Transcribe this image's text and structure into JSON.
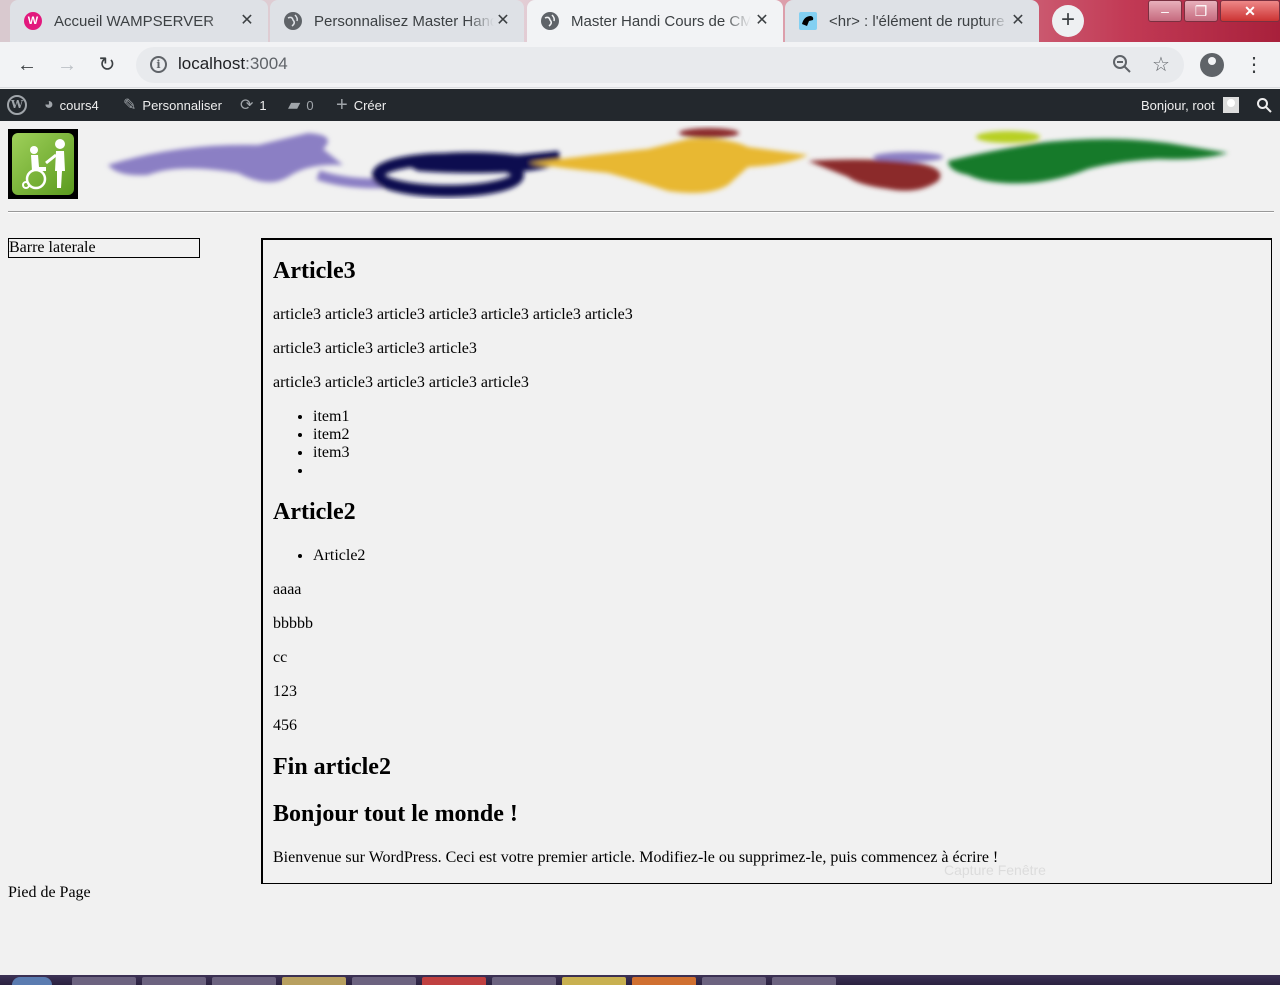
{
  "browser": {
    "tabs": [
      {
        "title": "Accueil WAMPSERVER",
        "favicon": "wampserver-icon",
        "active": false
      },
      {
        "title": "Personnalisez Master Handi",
        "favicon": "globe-icon",
        "active": false
      },
      {
        "title": "Master Handi Cours de CMS",
        "favicon": "globe-icon",
        "active": true
      },
      {
        "title": "<hr> : l'élément de rupture",
        "favicon": "mdn-icon",
        "active": false
      }
    ],
    "new_tab_label": "+",
    "close_glyph": "✕",
    "url_host": "localhost",
    "url_port": ":3004",
    "window_buttons": [
      "–",
      "❐",
      "✕"
    ]
  },
  "admin_bar": {
    "site_name": "cours4",
    "customize_label": "Personnaliser",
    "updates_count": "1",
    "comments_count": "0",
    "new_label": "Créer",
    "greeting": "Bonjour, root"
  },
  "page": {
    "sidebar_label": "Barre laterale",
    "footer_label": "Pied de Page",
    "ghost_caption": "Capture Fenêtre"
  },
  "articles": {
    "a3_title": "Article3",
    "a3_p1": "article3 article3 article3 article3 article3 article3 article3",
    "a3_p2": "article3 article3 article3 article3",
    "a3_p3": "article3 article3 article3 article3 article3",
    "a3_items": [
      "item1",
      "item2",
      "item3",
      ""
    ],
    "a2_title": "Article2",
    "a2_items": [
      "Article2"
    ],
    "a2_p1": "aaaa",
    "a2_p2": "bbbbb",
    "a2_p3": "cc",
    "a2_p4": "123",
    "a2_p5": "456",
    "a2_end_title": "Fin article2",
    "hello_title": "Bonjour tout le monde !",
    "hello_p": "Bienvenue sur WordPress. Ceci est votre premier article. Modifiez-le ou supprimez-le, puis commencez à écrire !"
  },
  "colors": {
    "admin_bar_bg": "#23282d",
    "page_bg": "#f1f1f1",
    "banner_purple": "#8b7fc4",
    "banner_navy": "#101050",
    "banner_yellow": "#e8b830",
    "banner_red": "#8b2a2a",
    "banner_green": "#127a2a"
  }
}
